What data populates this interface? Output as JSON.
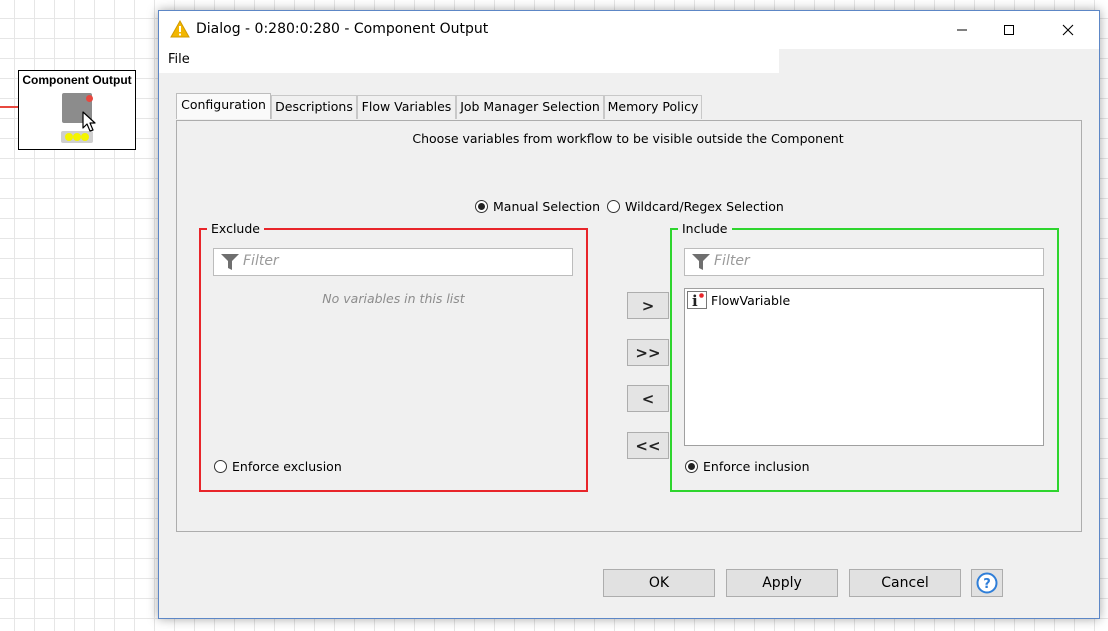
{
  "workflow": {
    "node_title": "Component Output"
  },
  "dialog": {
    "title": "Dialog - 0:280:0:280 - Component Output",
    "menu": {
      "file": "File"
    },
    "tabs": [
      {
        "label": "Configuration",
        "active": true
      },
      {
        "label": "Descriptions",
        "active": false
      },
      {
        "label": "Flow Variables",
        "active": false
      },
      {
        "label": "Job Manager Selection",
        "active": false
      },
      {
        "label": "Memory Policy",
        "active": false
      }
    ],
    "configuration": {
      "info_text": "Choose variables from workflow to be visible outside the Component",
      "selection_mode": {
        "manual_label": "Manual Selection",
        "wildcard_label": "Wildcard/Regex Selection",
        "selected": "manual"
      },
      "exclude": {
        "legend": "Exclude",
        "filter_placeholder": "Filter",
        "empty_message": "No variables in this list",
        "items": [],
        "enforce_label": "Enforce exclusion",
        "enforce_selected": false,
        "border_color": "#e8252a"
      },
      "include": {
        "legend": "Include",
        "filter_placeholder": "Filter",
        "items": [
          {
            "label": "FlowVariable",
            "icon": "flow-variable-icon"
          }
        ],
        "enforce_label": "Enforce inclusion",
        "enforce_selected": true,
        "border_color": "#2ed52e"
      },
      "move_buttons": {
        "add": ">",
        "add_all": ">>",
        "remove": "<",
        "remove_all": "<<"
      }
    },
    "footer": {
      "ok": "OK",
      "apply": "Apply",
      "cancel": "Cancel",
      "help_icon": "help-icon"
    }
  }
}
